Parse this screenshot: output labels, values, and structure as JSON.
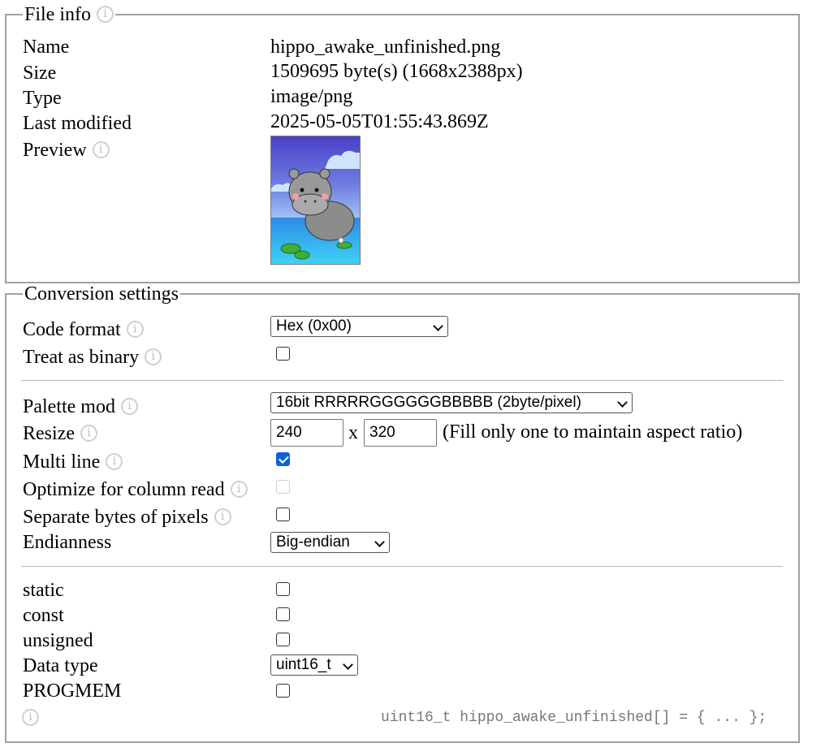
{
  "file_info": {
    "legend": "File info",
    "rows": [
      {
        "label": "Name",
        "value": "hippo_awake_unfinished.png"
      },
      {
        "label": "Size",
        "value": "1509695 byte(s) (1668x2388px)"
      },
      {
        "label": "Type",
        "value": "image/png"
      },
      {
        "label": "Last modified",
        "value": "2025-05-05T01:55:43.869Z"
      }
    ],
    "preview_label": "Preview"
  },
  "conversion": {
    "legend": "Conversion settings",
    "code_format": {
      "label": "Code format",
      "value": "Hex (0x00)"
    },
    "treat_as_binary": {
      "label": "Treat as binary",
      "checked": false
    },
    "palette_mod": {
      "label": "Palette mod",
      "value": "16bit RRRRRGGGGGGBBBBB (2byte/pixel)"
    },
    "resize": {
      "label": "Resize",
      "width": "240",
      "height": "320",
      "separator": "x",
      "hint": "(Fill only one to maintain aspect ratio)"
    },
    "multi_line": {
      "label": "Multi line",
      "checked": true
    },
    "optimize_column": {
      "label": "Optimize for column read",
      "checked": false,
      "disabled": true
    },
    "separate_bytes": {
      "label": "Separate bytes of pixels",
      "checked": false
    },
    "endianness": {
      "label": "Endianness",
      "value": "Big-endian"
    },
    "static": {
      "label": "static",
      "checked": false
    },
    "const": {
      "label": "const",
      "checked": false
    },
    "unsigned": {
      "label": "unsigned",
      "checked": false
    },
    "data_type": {
      "label": "Data type",
      "value": "uint16_t"
    },
    "progmem": {
      "label": "PROGMEM",
      "checked": false
    },
    "code_preview": "uint16_t hippo_awake_unfinished[] = { ... };"
  },
  "info_icon_glyph": "i"
}
